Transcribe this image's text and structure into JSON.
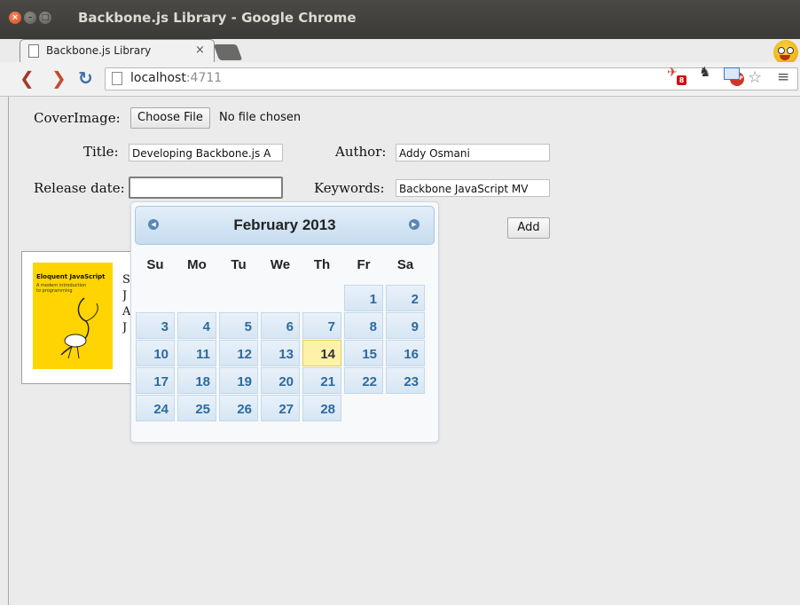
{
  "window": {
    "title": "Backbone.js Library - Google Chrome",
    "buttons": {
      "close": "×",
      "minimize": "–",
      "maximize": "□"
    }
  },
  "tab": {
    "title": "Backbone.js Library",
    "close": "×"
  },
  "toolbar": {
    "back": "❮",
    "forward": "❯",
    "reload": "↻",
    "url_host": "localhost",
    "url_port": ":4711",
    "abp": "ABP",
    "ext_badge": "8",
    "menu": "≡"
  },
  "form": {
    "cover_label": "CoverImage:",
    "choose_file": "Choose File",
    "no_file": "No file chosen",
    "title_label": "Title:",
    "title_value": "Developing Backbone.js A",
    "author_label": "Author:",
    "author_value": "Addy Osmani",
    "release_label": "Release date:",
    "release_value": "",
    "keywords_label": "Keywords:",
    "keywords_value": "Backbone JavaScript MV",
    "add_button": "Add"
  },
  "book": {
    "cover_title": "Eloquent JavaScript",
    "cover_subtitle": "A modern introduction to programming",
    "lines": [
      "S",
      "J",
      "A",
      "J"
    ]
  },
  "datepicker": {
    "month_title": "February 2013",
    "prev": "◀",
    "next": "▶",
    "weekdays": [
      "Su",
      "Mo",
      "Tu",
      "We",
      "Th",
      "Fr",
      "Sa"
    ],
    "first_weekday_index": 5,
    "days_in_month": 28,
    "today": 14
  }
}
